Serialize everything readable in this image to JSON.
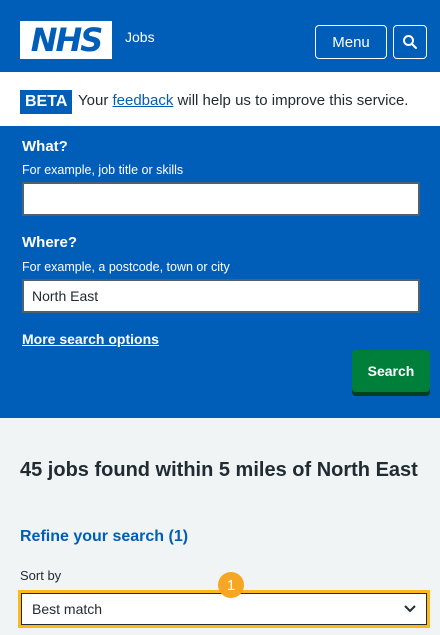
{
  "header": {
    "logo_text": "NHS",
    "service_name": "Jobs",
    "menu_label": "Menu",
    "search_icon": "search-icon"
  },
  "beta_banner": {
    "tag": "BETA",
    "text_before": "Your ",
    "link": "feedback",
    "text_after": " will help us to improve this service."
  },
  "search": {
    "what_label": "What?",
    "what_hint": "For example, job title or skills",
    "what_value": "",
    "where_label": "Where?",
    "where_hint": "For example, a postcode, town or city",
    "where_value": "North East",
    "more_options": "More search options",
    "submit_label": "Search"
  },
  "results": {
    "heading": "45 jobs found within 5 miles of North East",
    "refine_link": "Refine your search (1)",
    "sort_label": "Sort by",
    "sort_value": "Best match",
    "callout_number": "1"
  },
  "colors": {
    "nhs_blue": "#005eb8",
    "green": "#007f3b",
    "highlight": "#ffb81c",
    "callout": "#f5a623",
    "background": "#f0f4f5"
  }
}
